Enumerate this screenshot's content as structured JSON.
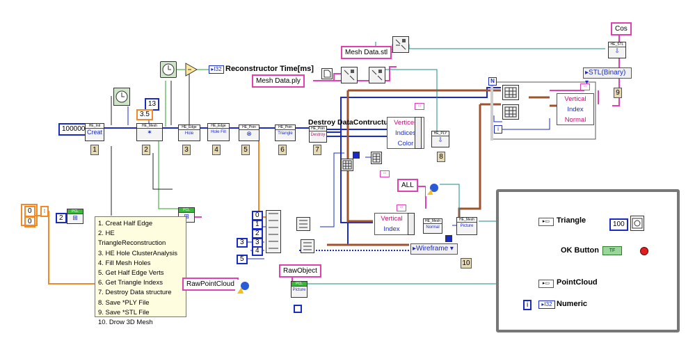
{
  "constants": {
    "iterations": "100000",
    "size_13": "13",
    "size_3_5": "3.5",
    "cos": "Cos",
    "mesh_stl": "Mesh Data.stl",
    "mesh_ply": "Mesh Data.ply",
    "all": "ALL",
    "raw_object": "RawObject",
    "raw_point_cloud": "RawPointCloud",
    "array_0a": "0",
    "array_0b": "0",
    "const_2": "2",
    "idx_0": "0",
    "idx_1": "1",
    "idx_2": "2",
    "idx_3a": "3",
    "idx_3b": "3",
    "idx_4": "4",
    "idx_5": "5",
    "wait_100": "100",
    "numeric_i": "i",
    "loop_i": "i",
    "loop_n": "N"
  },
  "labels": {
    "reconstructor_time": "Reconstructor Time[ms]",
    "destroy_data": "Destroy DataContructure",
    "triangle": "Triangle",
    "ok_button": "OK Button",
    "point_cloud": "PointCloud",
    "numeric": "Numeric",
    "i32": "I32",
    "tf": "TF"
  },
  "vis": {
    "he_init": [
      "HE_Init",
      "Creat"
    ],
    "he_mesh": [
      "HE_Mesh",
      "✶"
    ],
    "he_edge_hole": [
      "HE_Edge",
      "Hole"
    ],
    "he_edge_fill": [
      "HE_Edge",
      "Hole Fill"
    ],
    "he_point": [
      "HE_Poin",
      "⊗"
    ],
    "he_point_tri": [
      "HE_Poin",
      "Triangle"
    ],
    "he_destroy": [
      "HE_Poin",
      "Destroy"
    ],
    "he_ply": [
      "HE_PLY",
      "⇩"
    ],
    "he_stl": [
      "HE_STL",
      "⇩"
    ],
    "pcl_left": [
      "PCL",
      "⊞"
    ],
    "pcl_mid": [
      "PCL",
      "⊞"
    ],
    "pcl_bottom": [
      "PCL",
      "Picture"
    ],
    "he_mesh_normal": [
      "HE_Mesh",
      "Normal"
    ],
    "he_mesh_picture": [
      "HE_Mesh",
      "Picture"
    ]
  },
  "sequence_numbers": [
    "1",
    "2",
    "3",
    "4",
    "5",
    "6",
    "7",
    "8",
    "9",
    "10"
  ],
  "clusters": {
    "vertices_cluster": [
      "Vertices",
      "Indices",
      "Color"
    ],
    "vertical_index_mid": [
      "Vertical",
      "Index"
    ],
    "vertical_index_normal": [
      "Vertical",
      "Index",
      "Normal"
    ]
  },
  "rings": {
    "stl_format": "STL(Binary)",
    "render_mode": "Wireframe"
  },
  "comment_lines": [
    "1. Creat Half Edge",
    "2. HE TriangleReconstruction",
    "3. HE Hole ClusterAnalysis",
    "4. Fill Mesh Holes",
    "5. Get Half Edge Verts",
    "6. Get Triangle Indexs",
    "7. Destroy Data structure",
    "8. Save  *PLY File",
    "9. Save *STL File",
    "10. Drow 3D Mesh"
  ],
  "colors": {
    "wire_blue": "#1a2ac8",
    "wire_pink": "#e040b0",
    "wire_orange": "#f08a28",
    "wire_brown": "#a0522d",
    "wire_teal": "#1a8a8a",
    "wire_green": "#2aa02a",
    "panel_border": "#777777"
  }
}
